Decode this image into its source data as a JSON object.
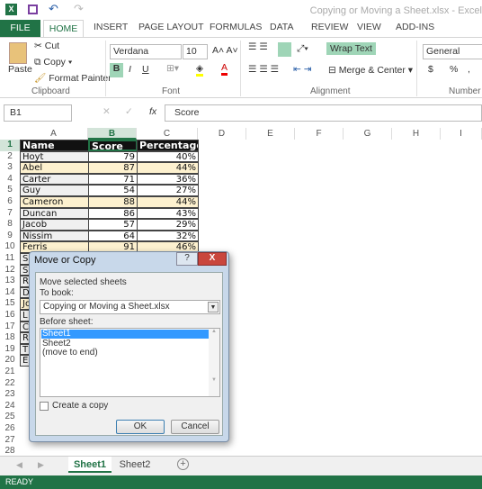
{
  "window": {
    "title": "Copying or Moving a Sheet.xlsx - Excel"
  },
  "ribbon_tabs": [
    "FILE",
    "HOME",
    "INSERT",
    "PAGE LAYOUT",
    "FORMULAS",
    "DATA",
    "REVIEW",
    "VIEW",
    "ADD-INS"
  ],
  "clipboard": {
    "paste": "Paste",
    "cut": "Cut",
    "copy": "Copy",
    "format_painter": "Format Painter",
    "group": "Clipboard"
  },
  "font": {
    "name": "Verdana",
    "size": "10",
    "group": "Font",
    "bold": "B",
    "italic": "I",
    "underline": "U"
  },
  "alignment": {
    "wrap_text": "Wrap Text",
    "merge_center": "Merge & Center",
    "group": "Alignment"
  },
  "number": {
    "format": "General",
    "currency": "$",
    "percent": "%",
    "comma": ",",
    "group": "Number"
  },
  "formula_bar": {
    "name_box": "B1",
    "fx": "fx",
    "value": "Score"
  },
  "columns": [
    "A",
    "B",
    "C",
    "D",
    "E",
    "F",
    "G",
    "H",
    "I"
  ],
  "headers": [
    "Name",
    "Score",
    "Percentage"
  ],
  "rows": [
    [
      "Hoyt",
      "79",
      "40%"
    ],
    [
      "Abel",
      "87",
      "44%"
    ],
    [
      "Carter",
      "71",
      "36%"
    ],
    [
      "Guy",
      "54",
      "27%"
    ],
    [
      "Cameron",
      "88",
      "44%"
    ],
    [
      "Duncan",
      "86",
      "43%"
    ],
    [
      "Jacob",
      "57",
      "29%"
    ],
    [
      "Nissim",
      "64",
      "32%"
    ],
    [
      "Ferris",
      "91",
      "46%"
    ],
    [
      "S",
      "",
      ""
    ],
    [
      "S",
      "",
      ""
    ],
    [
      "R",
      "",
      ""
    ],
    [
      "D",
      "",
      ""
    ],
    [
      "Jo",
      "",
      ""
    ],
    [
      "L",
      "",
      ""
    ],
    [
      "C",
      "",
      ""
    ],
    [
      "R",
      "",
      ""
    ],
    [
      "T",
      "",
      ""
    ],
    [
      "E",
      "",
      ""
    ]
  ],
  "row_numbers": [
    "1",
    "2",
    "3",
    "4",
    "5",
    "6",
    "7",
    "8",
    "9",
    "10",
    "11",
    "12",
    "13",
    "14",
    "15",
    "16",
    "17",
    "18",
    "19",
    "20",
    "21",
    "22",
    "23",
    "24",
    "25",
    "26",
    "27",
    "28"
  ],
  "dialog": {
    "title": "Move or Copy",
    "help": "?",
    "close": "X",
    "move_label": "Move selected sheets",
    "to_book_label": "To book:",
    "to_book_value": "Copying or Moving a Sheet.xlsx",
    "before_label": "Before sheet:",
    "sheets": [
      "Sheet1",
      "Sheet2",
      "(move to end)"
    ],
    "selected": "Sheet1",
    "create_copy": "Create a copy",
    "create_copy_checked": false,
    "ok": "OK",
    "cancel": "Cancel"
  },
  "sheet_tabs": [
    "Sheet1",
    "Sheet2"
  ],
  "active_sheet": "Sheet1",
  "status": "READY",
  "colors": {
    "accent": "#217346",
    "highlight": "#9fd5b7",
    "selection": "#3399ff"
  }
}
